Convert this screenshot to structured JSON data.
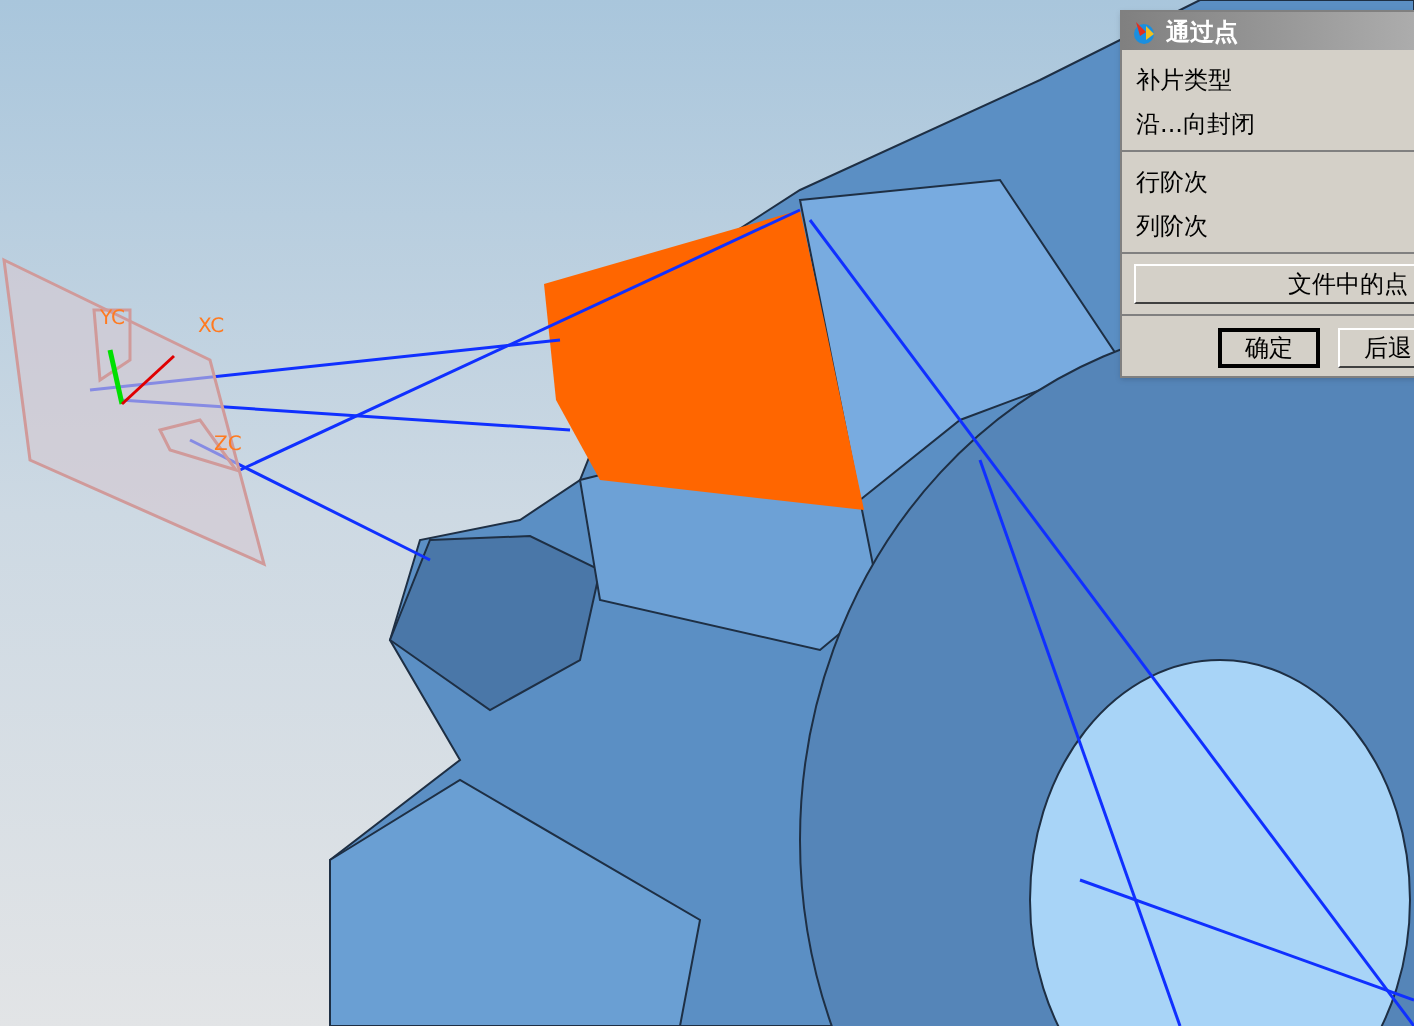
{
  "viewport": {
    "axis_labels": [
      {
        "kind": "yc",
        "text": "YC"
      },
      {
        "kind": "xc",
        "text": "XC"
      },
      {
        "kind": "zc",
        "text": "ZC"
      }
    ]
  },
  "dialog": {
    "title": "通过点",
    "sections": [
      [
        "补片类型",
        "沿...向封闭"
      ],
      [
        "行阶次",
        "列阶次"
      ]
    ],
    "file_button": "文件中的点",
    "buttons": [
      {
        "label": "确定",
        "default": true
      },
      {
        "label": "后退",
        "default": false
      }
    ]
  }
}
